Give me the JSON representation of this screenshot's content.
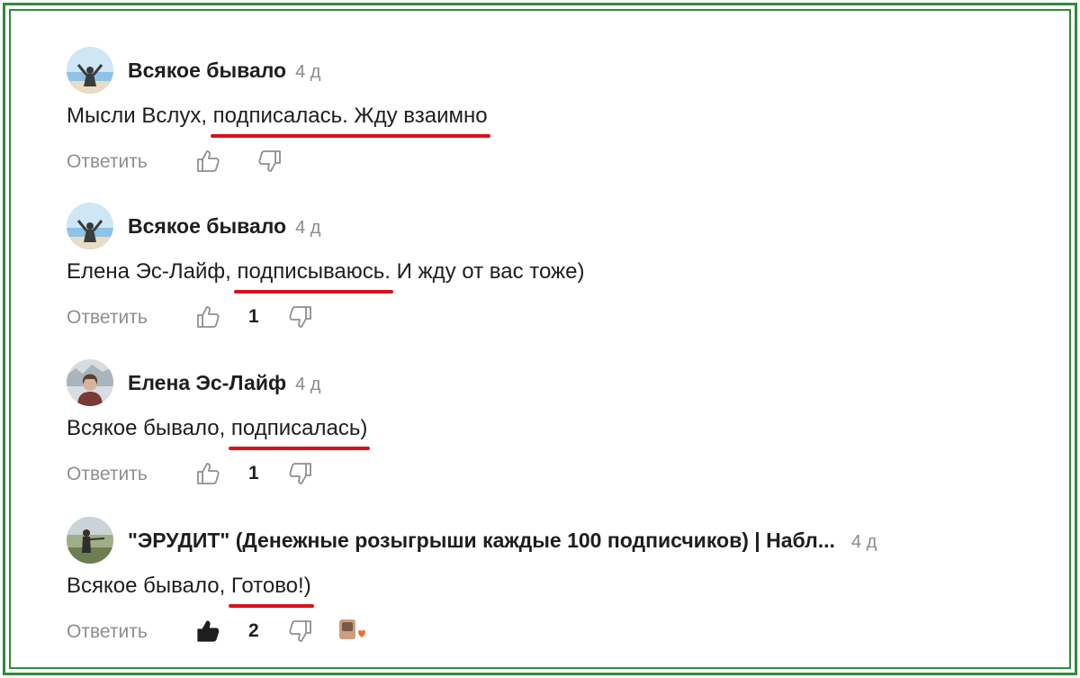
{
  "reply_label": "Ответить",
  "comments": [
    {
      "author": "Всякое бывало",
      "time": "4 д",
      "text_before": "Мысли Вслух,",
      "text_marked": "подписалась. Жду взаимно",
      "text_after": "",
      "likes": "",
      "liked": false
    },
    {
      "author": "Всякое бывало",
      "time": "4 д",
      "text_before": "Елена Эс-Лайф,",
      "text_marked": "подписываюсь.",
      "text_after": " И жду от вас тоже)",
      "likes": "1",
      "liked": false
    },
    {
      "author": "Елена Эс-Лайф",
      "time": "4 д",
      "text_before": "Всякое бывало,",
      "text_marked": "подписалась)",
      "text_after": "",
      "likes": "1",
      "liked": false
    },
    {
      "author": "\"ЭРУДИТ\" (Денежные розыгрыши каждые 100 подписчиков) | Набл...",
      "time": "4 д",
      "text_before": "Всякое бывало,",
      "text_marked": "Готово!)",
      "text_after": "",
      "likes": "2",
      "liked": true
    }
  ],
  "colors": {
    "frame": "#2e8b3a",
    "underline": "#d8121b",
    "muted": "#8e8e8e"
  }
}
